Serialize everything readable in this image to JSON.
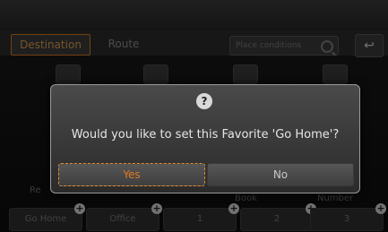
{
  "tabs": {
    "destination": "Destination",
    "route": "Route"
  },
  "search": {
    "placeholder": "Place conditions"
  },
  "background": {
    "labels": [
      "Re",
      "Book",
      "Number"
    ]
  },
  "favorites": [
    {
      "label": "Go Home"
    },
    {
      "label": "Office"
    },
    {
      "label": "1"
    },
    {
      "label": "2"
    },
    {
      "label": "3"
    }
  ],
  "dialog": {
    "message": "Would you like to set this Favorite 'Go Home'?",
    "yes_label": "Yes",
    "no_label": "No"
  },
  "colors": {
    "accent": "#e07a1e"
  },
  "icons": {
    "help": "question-icon",
    "back": "back-arrow-icon"
  }
}
